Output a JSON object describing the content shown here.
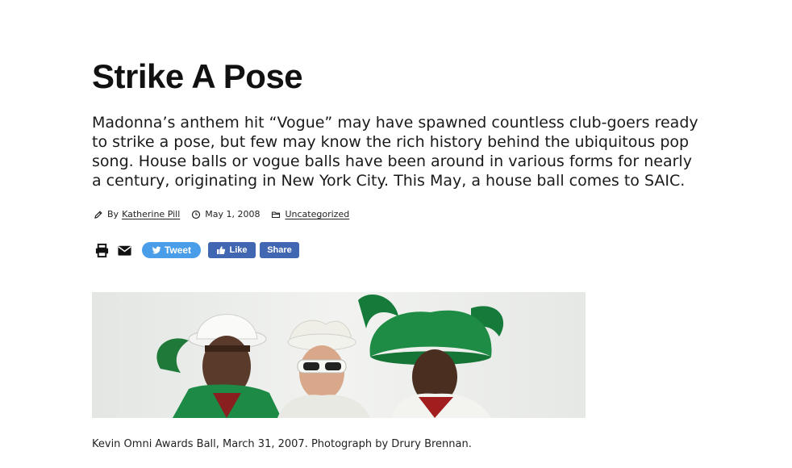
{
  "article": {
    "title": "Strike A Pose",
    "dek": "Madonna’s anthem hit “Vogue” may have spawned countless club-goers ready to strike a pose, but few may know the rich history behind the ubiquitous pop song. House balls or vogue balls have been around in various forms for nearly a century, originating in New York City. This May, a house ball comes to SAIC.",
    "meta": {
      "by_label": "By",
      "author": "Katherine Pill",
      "date": "May 1, 2008",
      "category": "Uncategorized",
      "icons": [
        "pencil-icon",
        "clock-icon",
        "folder-icon"
      ]
    },
    "share": {
      "print_icon": "print-icon",
      "email_icon": "envelope-icon",
      "tweet_label": "Tweet",
      "like_label": "Like",
      "share_label": "Share",
      "colors": {
        "twitter": "#4a9ee9",
        "facebook": "#4267b2"
      }
    },
    "image": {
      "caption": "Kevin Omni Awards Ball, March 31, 2007. Photograph by Drury Brennan."
    }
  }
}
